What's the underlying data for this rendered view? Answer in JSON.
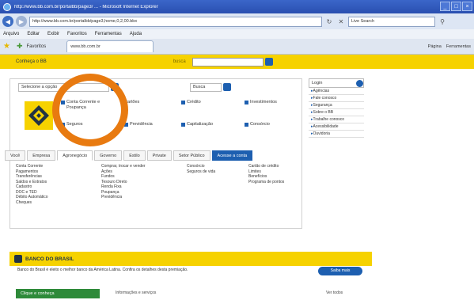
{
  "window": {
    "title": "http://www.bb.com.br/portalbb/page3/ ... - Microsoft Internet Explorer",
    "buttons": [
      "_",
      "□",
      "×"
    ]
  },
  "address_bar": {
    "url": "http://www.bb.com.br/portalbb/page3,home,0,2,00.bbx",
    "search_value": "Live Search"
  },
  "menu": {
    "items": [
      "Arquivo",
      "Editar",
      "Exibir",
      "Favoritos",
      "Ferramentas",
      "Ajuda"
    ]
  },
  "favorites": {
    "label": "Favoritos",
    "tab_label": "www.bb.com.br",
    "commands": [
      "Página",
      "Ferramentas"
    ]
  },
  "bb_bar": {
    "prefix": "Conheça o BB",
    "mid": "busca",
    "search_value": ""
  },
  "panel": {
    "quick_select": "Selecione a opção",
    "quick_right": "Busca",
    "services": [
      {
        "label": "Conta Corrente e Poupança"
      },
      {
        "label": "Cartões"
      },
      {
        "label": "Crédito"
      },
      {
        "label": "Investimentos"
      },
      {
        "label": "Seguros"
      },
      {
        "label": "Previdência"
      },
      {
        "label": "Capitalização"
      },
      {
        "label": "Consórcio"
      }
    ],
    "categories": [
      "Você",
      "Empresa",
      "Agronegócio",
      "Governo",
      "Estilo",
      "Private",
      "Setor Público",
      "Acesse a conta"
    ],
    "link_cols": [
      [
        "Conta Corrente",
        "Pagamentos",
        "Transferências",
        "Saldos e Extratos",
        "Cadastro",
        "DOC e TED",
        "Débito Automático",
        "Cheques"
      ],
      [
        "Comprar, trocar e vender",
        "Ações",
        "Fundos",
        "Tesouro Direto",
        "Renda Fixa",
        "Poupança",
        "Previdência"
      ],
      [
        "Consórcio",
        "Seguros de vida"
      ],
      [
        "Cartão de crédito",
        "Limites",
        "Benefícios",
        "Programa de pontos"
      ]
    ]
  },
  "right_panel": {
    "top": "Login",
    "items": [
      "Agências",
      "Fale conosco",
      "Segurança",
      "Sobre o BB",
      "Trabalhe conosco",
      "Acessibilidade",
      "Ouvidoria"
    ]
  },
  "band": {
    "title": "BANCO DO BRASIL",
    "notice": "Banco do Brasil é eleito o melhor banco da América Latina. Confira os detalhes desta premiação.",
    "button": "Saiba mais"
  },
  "footer": {
    "green_box": "Clique e conheça",
    "last_line": "Informações e serviços",
    "last_right": "Ver todos"
  },
  "colors": {
    "bb_yellow": "#f6d200",
    "bb_blue": "#1d5fb0",
    "highlight": "#e87a10"
  }
}
